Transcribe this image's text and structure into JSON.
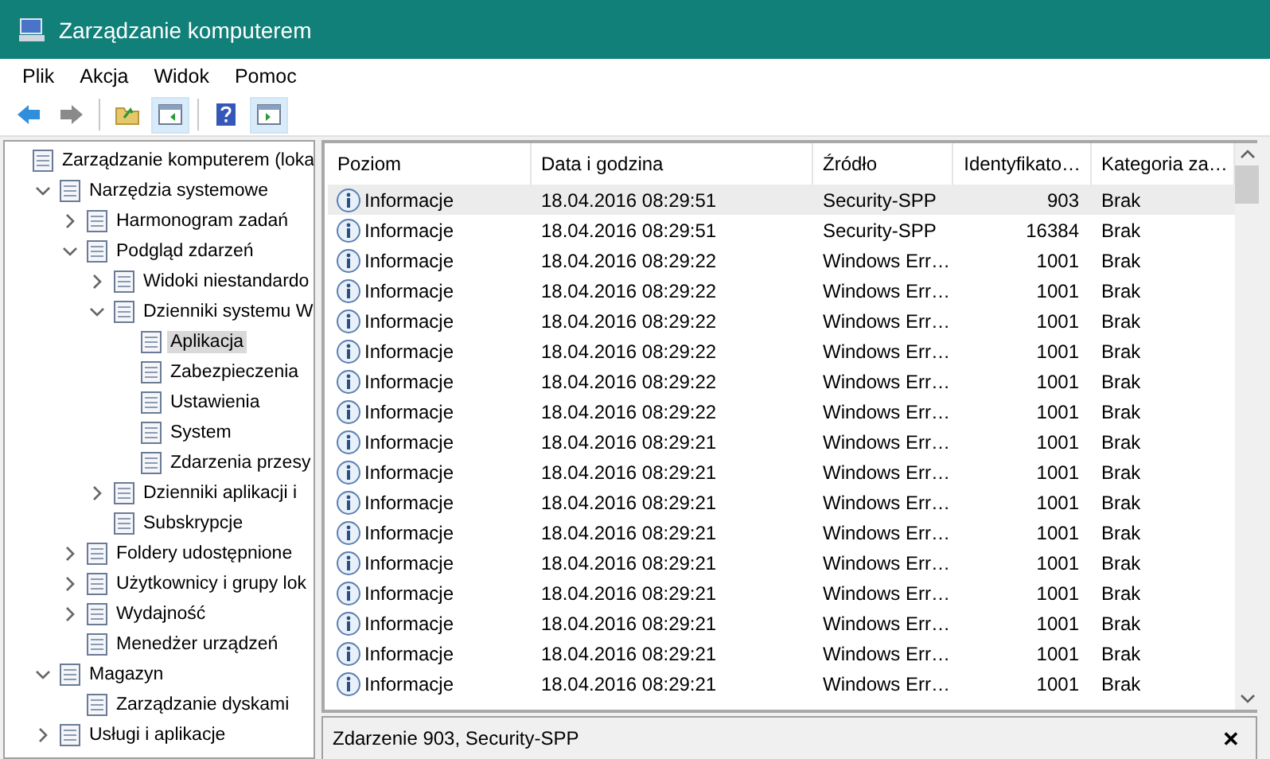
{
  "window": {
    "title": "Zarządzanie komputerem"
  },
  "menu": [
    "Plik",
    "Akcja",
    "Widok",
    "Pomoc"
  ],
  "tree": [
    {
      "label": "Zarządzanie komputerem (loka",
      "selected": false,
      "children": [
        {
          "label": "Narzędzia systemowe",
          "expanded": true,
          "selected": false,
          "children": [
            {
              "label": "Harmonogram zadań",
              "expanded": false,
              "selected": false
            },
            {
              "label": "Podgląd zdarzeń",
              "expanded": true,
              "selected": false,
              "children": [
                {
                  "label": "Widoki niestandardo",
                  "expanded": false,
                  "selected": false
                },
                {
                  "label": "Dzienniki systemu W",
                  "expanded": true,
                  "selected": false,
                  "children": [
                    {
                      "label": "Aplikacja",
                      "selected": true
                    },
                    {
                      "label": "Zabezpieczenia",
                      "selected": false
                    },
                    {
                      "label": "Ustawienia",
                      "selected": false
                    },
                    {
                      "label": "System",
                      "selected": false
                    },
                    {
                      "label": "Zdarzenia przesy",
                      "selected": false
                    }
                  ]
                },
                {
                  "label": "Dzienniki aplikacji i",
                  "expanded": false,
                  "selected": false
                },
                {
                  "label": "Subskrypcje",
                  "selected": false
                }
              ]
            },
            {
              "label": "Foldery udostępnione",
              "expanded": false,
              "selected": false
            },
            {
              "label": "Użytkownicy i grupy lok",
              "expanded": false,
              "selected": false
            },
            {
              "label": "Wydajność",
              "expanded": false,
              "selected": false
            },
            {
              "label": "Menedżer urządzeń",
              "selected": false
            }
          ]
        },
        {
          "label": "Magazyn",
          "expanded": true,
          "selected": false,
          "children": [
            {
              "label": "Zarządzanie dyskami",
              "selected": false
            }
          ]
        },
        {
          "label": "Usługi i aplikacje",
          "expanded": false,
          "selected": false
        }
      ]
    }
  ],
  "table": {
    "columns": [
      "Poziom",
      "Data i godzina",
      "Źródło",
      "Identyfikato…",
      "Kategoria za…"
    ],
    "rows": [
      {
        "cells": [
          "Informacje",
          "18.04.2016 08:29:51",
          "Security-SPP",
          "903",
          "Brak"
        ],
        "selected": true
      },
      {
        "cells": [
          "Informacje",
          "18.04.2016 08:29:51",
          "Security-SPP",
          "16384",
          "Brak"
        ],
        "selected": false
      },
      {
        "cells": [
          "Informacje",
          "18.04.2016 08:29:22",
          "Windows Err…",
          "1001",
          "Brak"
        ],
        "selected": false
      },
      {
        "cells": [
          "Informacje",
          "18.04.2016 08:29:22",
          "Windows Err…",
          "1001",
          "Brak"
        ],
        "selected": false
      },
      {
        "cells": [
          "Informacje",
          "18.04.2016 08:29:22",
          "Windows Err…",
          "1001",
          "Brak"
        ],
        "selected": false
      },
      {
        "cells": [
          "Informacje",
          "18.04.2016 08:29:22",
          "Windows Err…",
          "1001",
          "Brak"
        ],
        "selected": false
      },
      {
        "cells": [
          "Informacje",
          "18.04.2016 08:29:22",
          "Windows Err…",
          "1001",
          "Brak"
        ],
        "selected": false
      },
      {
        "cells": [
          "Informacje",
          "18.04.2016 08:29:22",
          "Windows Err…",
          "1001",
          "Brak"
        ],
        "selected": false
      },
      {
        "cells": [
          "Informacje",
          "18.04.2016 08:29:21",
          "Windows Err…",
          "1001",
          "Brak"
        ],
        "selected": false
      },
      {
        "cells": [
          "Informacje",
          "18.04.2016 08:29:21",
          "Windows Err…",
          "1001",
          "Brak"
        ],
        "selected": false
      },
      {
        "cells": [
          "Informacje",
          "18.04.2016 08:29:21",
          "Windows Err…",
          "1001",
          "Brak"
        ],
        "selected": false
      },
      {
        "cells": [
          "Informacje",
          "18.04.2016 08:29:21",
          "Windows Err…",
          "1001",
          "Brak"
        ],
        "selected": false
      },
      {
        "cells": [
          "Informacje",
          "18.04.2016 08:29:21",
          "Windows Err…",
          "1001",
          "Brak"
        ],
        "selected": false
      },
      {
        "cells": [
          "Informacje",
          "18.04.2016 08:29:21",
          "Windows Err…",
          "1001",
          "Brak"
        ],
        "selected": false
      },
      {
        "cells": [
          "Informacje",
          "18.04.2016 08:29:21",
          "Windows Err…",
          "1001",
          "Brak"
        ],
        "selected": false
      },
      {
        "cells": [
          "Informacje",
          "18.04.2016 08:29:21",
          "Windows Err…",
          "1001",
          "Brak"
        ],
        "selected": false
      },
      {
        "cells": [
          "Informacje",
          "18.04.2016 08:29:21",
          "Windows Err…",
          "1001",
          "Brak"
        ],
        "selected": false
      }
    ]
  },
  "detail": {
    "title": "Zdarzenie 903, Security-SPP",
    "close": "✕"
  }
}
